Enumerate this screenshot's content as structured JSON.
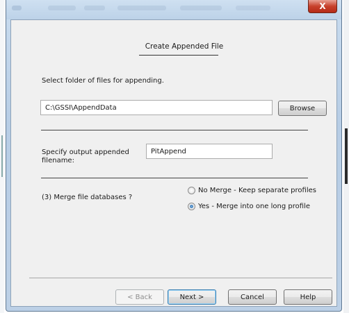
{
  "window": {
    "close_glyph": "X"
  },
  "heading": "Create Appended File",
  "folder": {
    "label": "Select folder of files for appending.",
    "path": "C:\\GSSI\\AppendData",
    "browse_label": "Browse"
  },
  "output": {
    "label_line1": "Specify output appended",
    "label_line2": "filename:",
    "value": "PitAppend"
  },
  "merge": {
    "label": "(3) Merge file databases ?",
    "options": [
      {
        "label": "No Merge - Keep separate profiles",
        "checked": false
      },
      {
        "label": "Yes - Merge into one long profile",
        "checked": true
      }
    ]
  },
  "buttons": {
    "back": "< Back",
    "next": "Next >",
    "cancel": "Cancel",
    "help": "Help"
  },
  "icons": {
    "close": "close-icon",
    "radio_unchecked": "radio-unchecked-icon",
    "radio_checked": "radio-checked-icon"
  }
}
